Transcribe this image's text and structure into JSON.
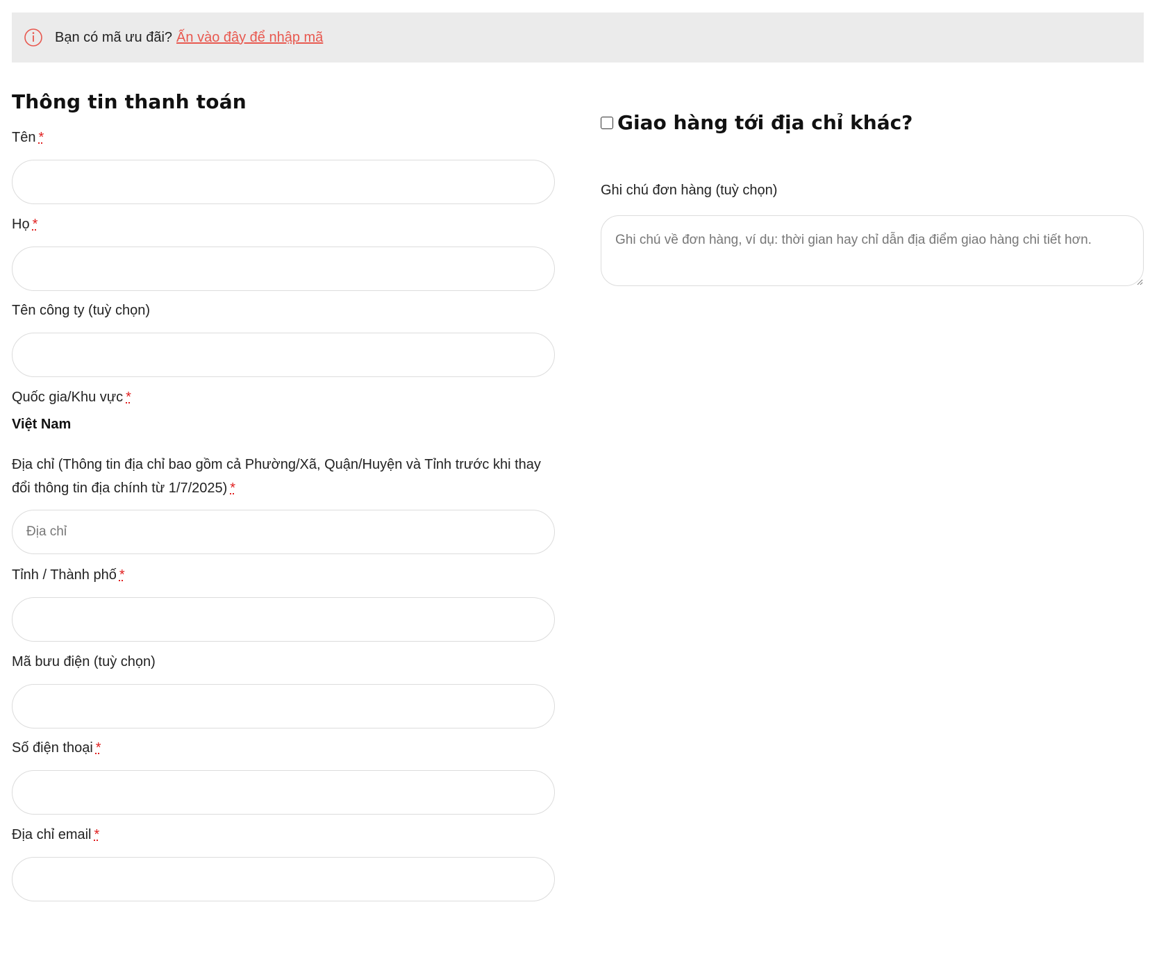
{
  "coupon": {
    "icon": "info-icon",
    "text": "Bạn có mã ưu đãi?",
    "link": "Ấn vào đây để nhập mã",
    "accent_color": "#e8584f"
  },
  "billing": {
    "title": "Thông tin thanh toán",
    "required_mark": "*",
    "first_name_label": "Tên",
    "last_name_label": "Họ",
    "company_label": "Tên công ty (tuỳ chọn)",
    "country_label": "Quốc gia/Khu vực",
    "country_value": "Việt Nam",
    "address_label": "Địa chỉ (Thông tin địa chỉ bao gồm cả Phường/Xã, Quận/Huyện và Tỉnh trước khi thay đổi thông tin địa chính từ 1/7/2025)",
    "address_placeholder": "Địa chỉ",
    "city_label": "Tỉnh / Thành phố",
    "postcode_label": "Mã bưu điện (tuỳ chọn)",
    "phone_label": "Số điện thoại",
    "email_label": "Địa chỉ email"
  },
  "shipping": {
    "title": "Giao hàng tới địa chỉ khác?",
    "checked": false
  },
  "notes": {
    "label": "Ghi chú đơn hàng (tuỳ chọn)",
    "placeholder": "Ghi chú về đơn hàng, ví dụ: thời gian hay chỉ dẫn địa điểm giao hàng chi tiết hơn."
  }
}
